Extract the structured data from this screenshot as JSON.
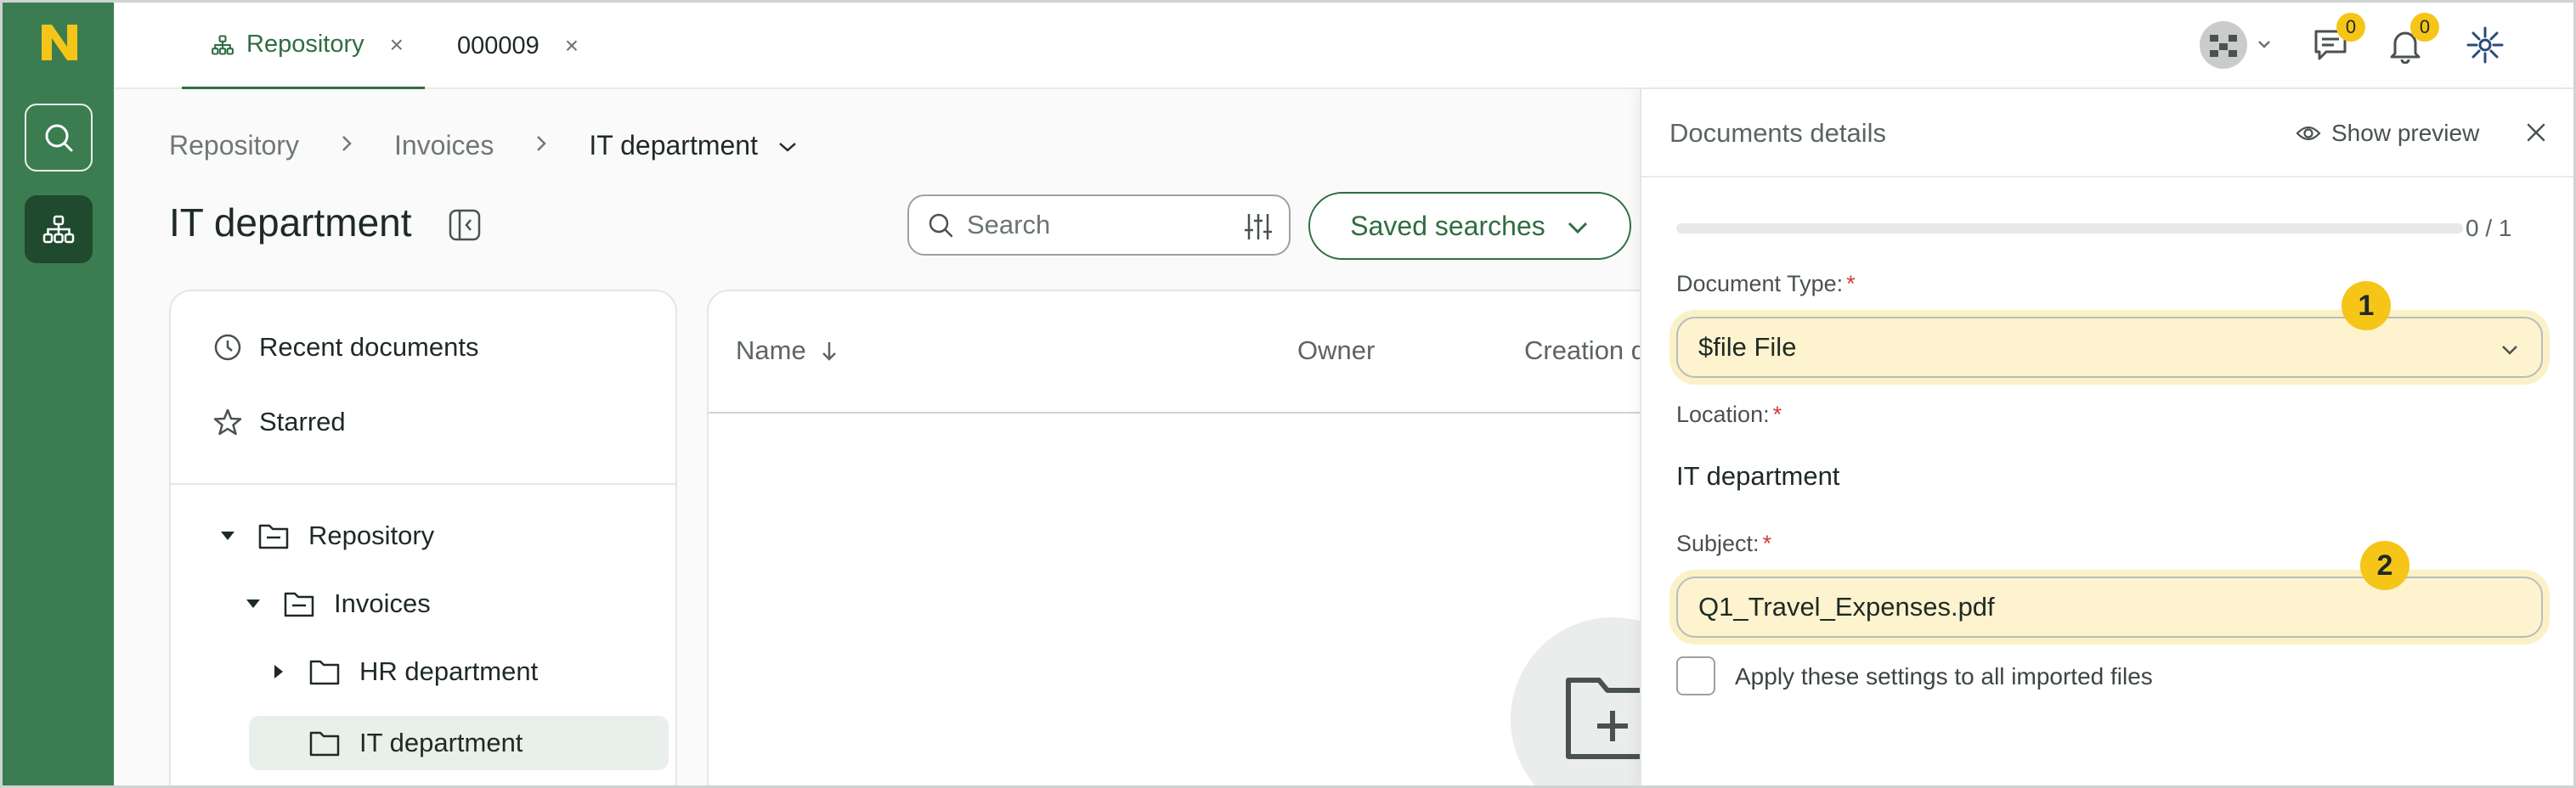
{
  "brand": {
    "rail_color": "#3b7d51",
    "logo_color": "#f5c518",
    "accent": "#2f6d44",
    "highlight": "#fdf3cf"
  },
  "tabs": [
    {
      "label": "Repository",
      "active": true,
      "icon": "sitemap-icon"
    },
    {
      "label": "000009",
      "active": false
    }
  ],
  "tab_close_glyph": "×",
  "top_icons": {
    "chat_badge": "0",
    "notification_badge": "0"
  },
  "breadcrumb": [
    "Repository",
    "Invoices",
    "IT department"
  ],
  "page_title": "IT department",
  "search": {
    "placeholder": "Search"
  },
  "saved_searches_label": "Saved searches",
  "nav": {
    "recent": "Recent documents",
    "starred": "Starred",
    "tree": [
      {
        "label": "Repository",
        "expanded": true,
        "level": 0
      },
      {
        "label": "Invoices",
        "expanded": true,
        "level": 1
      },
      {
        "label": "HR department",
        "expanded": false,
        "level": 2
      },
      {
        "label": "IT department",
        "selected": true,
        "level": 2
      }
    ]
  },
  "list": {
    "columns": [
      "Name",
      "Owner",
      "Creation d"
    ]
  },
  "drawer": {
    "title": "Documents details",
    "show_preview": "Show preview",
    "progress_text": "0 / 1",
    "progress_fraction": 0,
    "document_type_label": "Document Type:",
    "document_type_value": "$file File",
    "location_label": "Location:",
    "location_value": "IT department",
    "subject_label": "Subject:",
    "subject_value": "Q1_Travel_Expenses.pdf",
    "apply_all_label": "Apply these settings to all imported files",
    "marker_1": "1",
    "marker_2": "2",
    "required_mark": "*"
  }
}
